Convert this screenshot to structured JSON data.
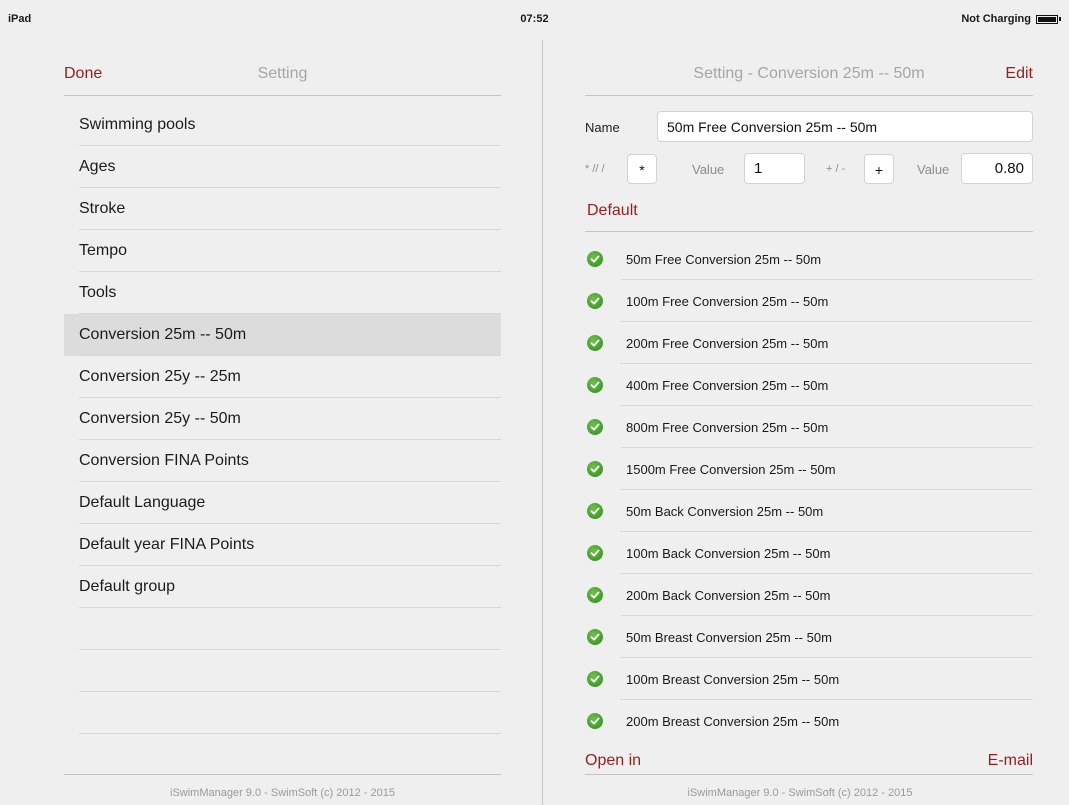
{
  "status_bar": {
    "device": "iPad",
    "time": "07:52",
    "battery_text": "Not Charging"
  },
  "left_panel": {
    "done_label": "Done",
    "title": "Setting",
    "menu": [
      {
        "label": "Swimming pools"
      },
      {
        "label": "Ages"
      },
      {
        "label": "Stroke"
      },
      {
        "label": "Tempo"
      },
      {
        "label": "Tools"
      },
      {
        "label": "Conversion 25m -- 50m",
        "selected": true
      },
      {
        "label": "Conversion 25y -- 25m"
      },
      {
        "label": "Conversion 25y -- 50m"
      },
      {
        "label": "Conversion FINA Points"
      },
      {
        "label": "Default Language"
      },
      {
        "label": "Default year FINA Points"
      },
      {
        "label": "Default group"
      }
    ],
    "footer": "iSwimManager 9.0 - SwimSoft (c) 2012 - 2015"
  },
  "right_panel": {
    "title": "Setting - Conversion 25m -- 50m",
    "edit_label": "Edit",
    "name_label": "Name",
    "name_value": "50m Free Conversion 25m -- 50m",
    "operator1_label": "* // /",
    "operator1_value": "*",
    "value1_label": "Value",
    "value1": "1",
    "operator2_label": "+ / -",
    "operator2_value": "+",
    "value2_label": "Value",
    "value2": "0.80",
    "default_label": "Default",
    "conversions": [
      {
        "label": "50m Free Conversion 25m -- 50m",
        "icon": "check-icon"
      },
      {
        "label": "100m Free Conversion 25m -- 50m",
        "icon": "check-icon"
      },
      {
        "label": "200m Free Conversion 25m -- 50m",
        "icon": "check-icon"
      },
      {
        "label": "400m Free Conversion 25m -- 50m",
        "icon": "check-icon"
      },
      {
        "label": "800m Free Conversion 25m -- 50m",
        "icon": "check-icon"
      },
      {
        "label": "1500m Free Conversion 25m -- 50m",
        "icon": "check-icon"
      },
      {
        "label": "50m Back Conversion 25m -- 50m",
        "icon": "check-icon"
      },
      {
        "label": "100m Back Conversion 25m -- 50m",
        "icon": "check-icon"
      },
      {
        "label": "200m Back Conversion 25m -- 50m",
        "icon": "check-icon"
      },
      {
        "label": "50m Breast Conversion 25m -- 50m",
        "icon": "check-icon"
      },
      {
        "label": "100m Breast Conversion 25m -- 50m",
        "icon": "check-icon"
      },
      {
        "label": "200m Breast Conversion 25m -- 50m",
        "icon": "check-icon"
      }
    ],
    "open_in_label": "Open in",
    "email_label": "E-mail",
    "footer": "iSwimManager 9.0 - SwimSoft (c) 2012 - 2015"
  },
  "colors": {
    "accent": "#9b1c1c",
    "check": "#3f9b2a",
    "background": "#efefef"
  }
}
